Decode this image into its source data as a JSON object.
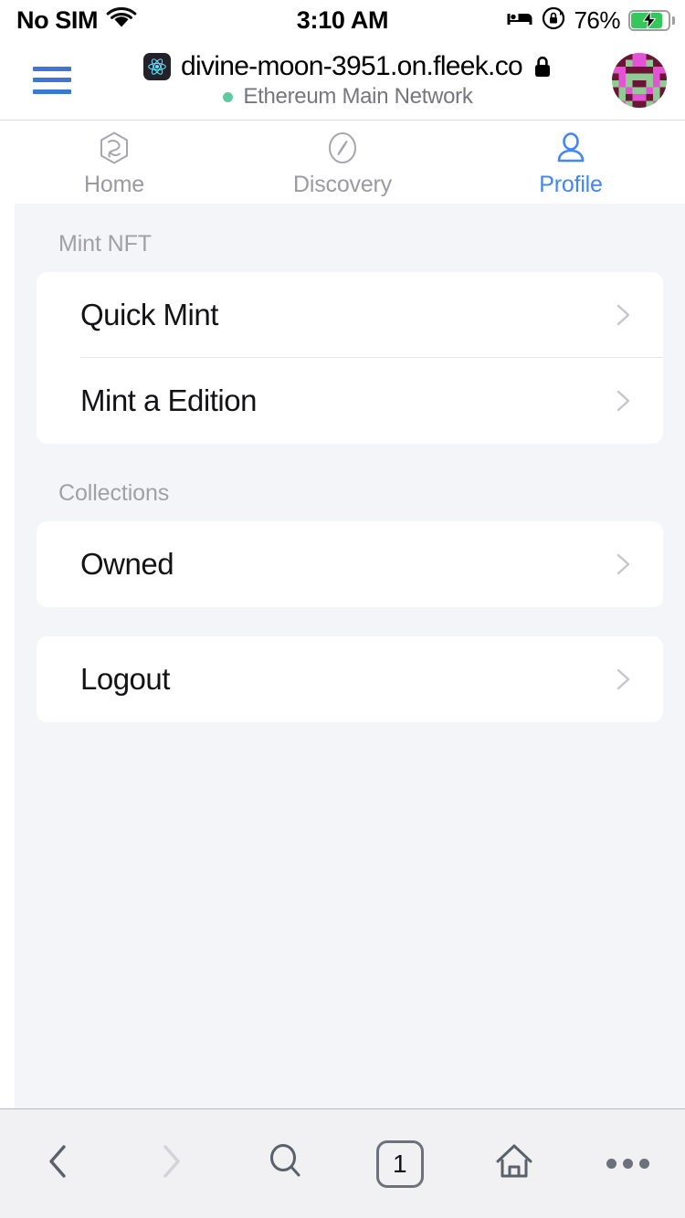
{
  "status_bar": {
    "carrier": "No SIM",
    "wifi_icon": "wifi-icon",
    "time": "3:10 AM",
    "sleep_icon": "bed-icon",
    "rotation_lock_icon": "rotation-lock-icon",
    "battery_percent": "76%",
    "battery_icon": "battery-charging-icon",
    "battery_level": 76,
    "battery_fill_color": "#34C759"
  },
  "browser": {
    "menu_icon": "hamburger-menu-icon",
    "menu_color": "#3B77D4",
    "favicon": "react-logo-icon",
    "url": "divine-moon-3951.on.fleek.co",
    "secure_icon": "lock-icon",
    "network_status": "Ethereum Main Network",
    "network_dot_color": "#5FC9A0",
    "avatar": "blockies-avatar",
    "avatar_colors": [
      "#8FCB93",
      "#E354D4",
      "#6B1436"
    ]
  },
  "tabs": [
    {
      "label": "Home",
      "icon": "hexagon-logo-icon",
      "active": false
    },
    {
      "label": "Discovery",
      "icon": "compass-icon",
      "active": false
    },
    {
      "label": "Profile",
      "icon": "person-icon",
      "active": true
    }
  ],
  "theme": {
    "page_background": "#F4F5F9",
    "card_background": "#FFFFFF",
    "accent": "#4285F4",
    "muted_text": "#9A9AA0",
    "primary_text": "#131316",
    "toolbar_background": "#F1F1F3"
  },
  "sections": [
    {
      "title": "Mint NFT",
      "rows": [
        {
          "label": "Quick Mint",
          "chevron": "chevron-right-icon"
        },
        {
          "label": "Mint a Edition",
          "chevron": "chevron-right-icon"
        }
      ]
    },
    {
      "title": "Collections",
      "rows": [
        {
          "label": "Owned",
          "chevron": "chevron-right-icon"
        }
      ]
    }
  ],
  "logout": {
    "label": "Logout",
    "chevron": "chevron-right-icon"
  },
  "toolbar": {
    "back_icon": "chevron-left-icon",
    "forward_icon": "chevron-right-icon",
    "search_icon": "magnifier-icon",
    "tab_count": "1",
    "home_icon": "home-icon",
    "more_icon": "ellipsis-icon"
  }
}
